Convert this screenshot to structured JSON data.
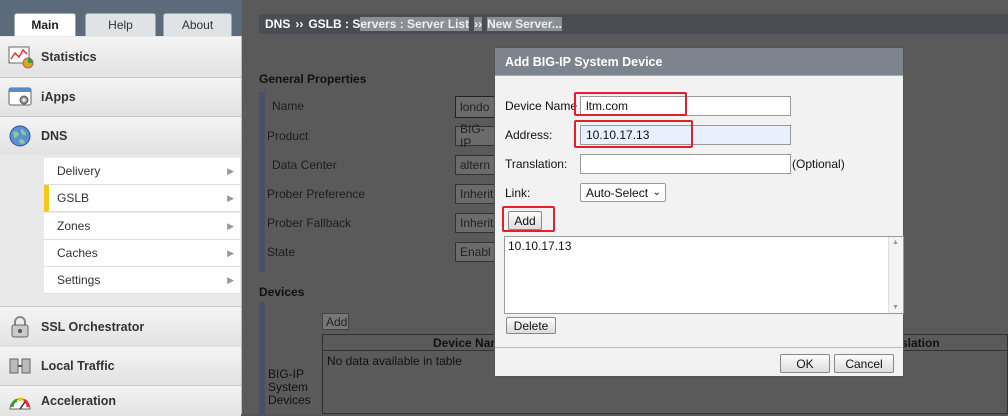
{
  "top_tabs": [
    {
      "label": "Main",
      "active": true
    },
    {
      "label": "Help",
      "active": false
    },
    {
      "label": "About",
      "active": false
    }
  ],
  "nav": {
    "sections_top": [
      {
        "label": "Statistics",
        "icon": "statistics-icon"
      },
      {
        "label": "iApps",
        "icon": "iapps-icon"
      },
      {
        "label": "DNS",
        "icon": "dns-globe-icon"
      }
    ],
    "dns_items": [
      {
        "label": "Delivery"
      },
      {
        "label": "GSLB"
      },
      {
        "label": "Zones"
      },
      {
        "label": "Caches"
      },
      {
        "label": "Settings"
      }
    ],
    "sections_bottom": [
      {
        "label": "SSL Orchestrator",
        "icon": "ssl-lock-icon"
      },
      {
        "label": "Local Traffic",
        "icon": "local-traffic-icon"
      },
      {
        "label": "Acceleration",
        "icon": "acceleration-gauge-icon"
      }
    ]
  },
  "breadcrumb": {
    "part1": "DNS",
    "sep": "››",
    "part2": "GSLB : S",
    "part3": "ervers : Server List",
    "part4": "New Server..."
  },
  "form": {
    "general_title": "General Properties",
    "rows": [
      {
        "label": "Name",
        "value": "londo"
      },
      {
        "label": "Product",
        "value": "BIG-IP"
      },
      {
        "label": "Data Center",
        "value": "altern"
      },
      {
        "label": "Prober Preference",
        "value": "Inherit"
      },
      {
        "label": "Prober Fallback",
        "value": "Inherit"
      },
      {
        "label": "State",
        "value": "Enabl"
      }
    ],
    "devices_title": "Devices",
    "devices_row_label": "BIG-IP System Devices",
    "add_label": "Add",
    "device_name_header": "Device Nam",
    "translation_header": "slation",
    "empty_text": "No data available in table"
  },
  "dialog": {
    "title": "Add BIG-IP System Device",
    "device_name_label": "Device Name",
    "device_name_value": "ltm.com",
    "address_label": "Address:",
    "address_value": "10.10.17.13",
    "translation_label": "Translation:",
    "translation_value": "",
    "optional_label": "(Optional)",
    "link_label": "Link:",
    "link_value": "Auto-Select",
    "add_label": "Add",
    "list_items": [
      "10.10.17.13"
    ],
    "delete_label": "Delete",
    "ok_label": "OK",
    "cancel_label": "Cancel"
  },
  "colors": {
    "highlight_red": "#e0202a",
    "dialog_header": "#7d848d",
    "nav_selected_marker": "#f2c81a"
  }
}
